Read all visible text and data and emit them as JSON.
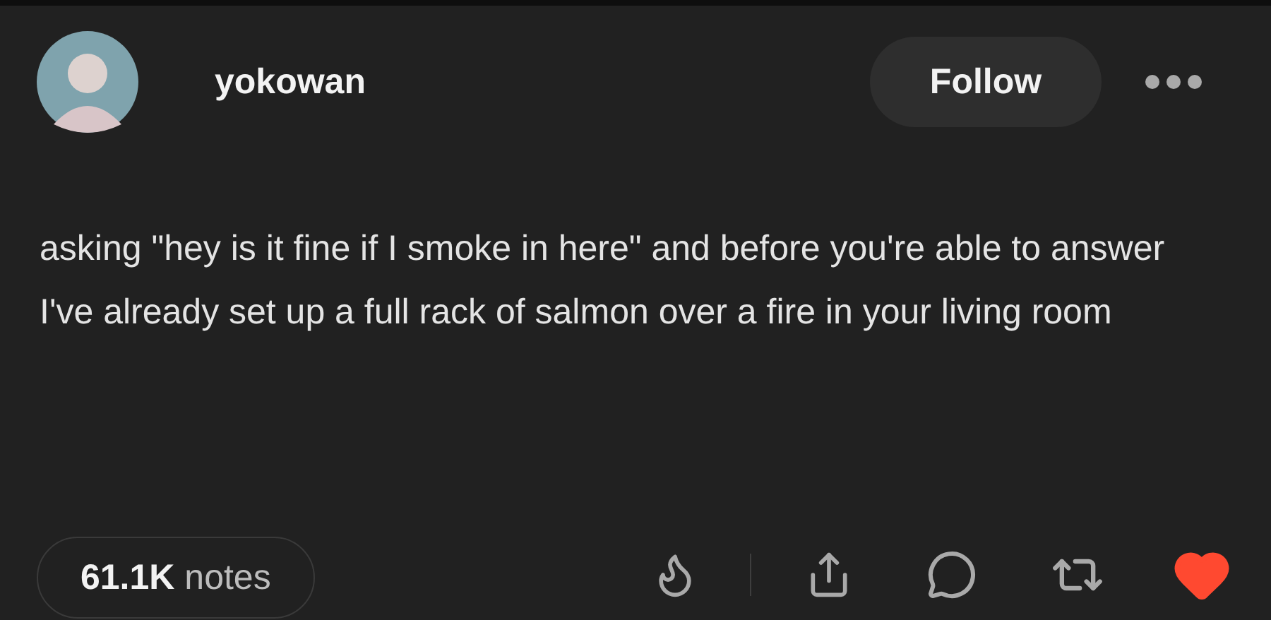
{
  "post": {
    "username": "yokowan",
    "follow_button": "Follow",
    "body": "asking \"hey is it fine if I smoke in here\" and before you're able to answer I've already set up a full rack of salmon over a fire in your living room",
    "notes": "**61.1K** notes",
    "liked": true
  }
}
